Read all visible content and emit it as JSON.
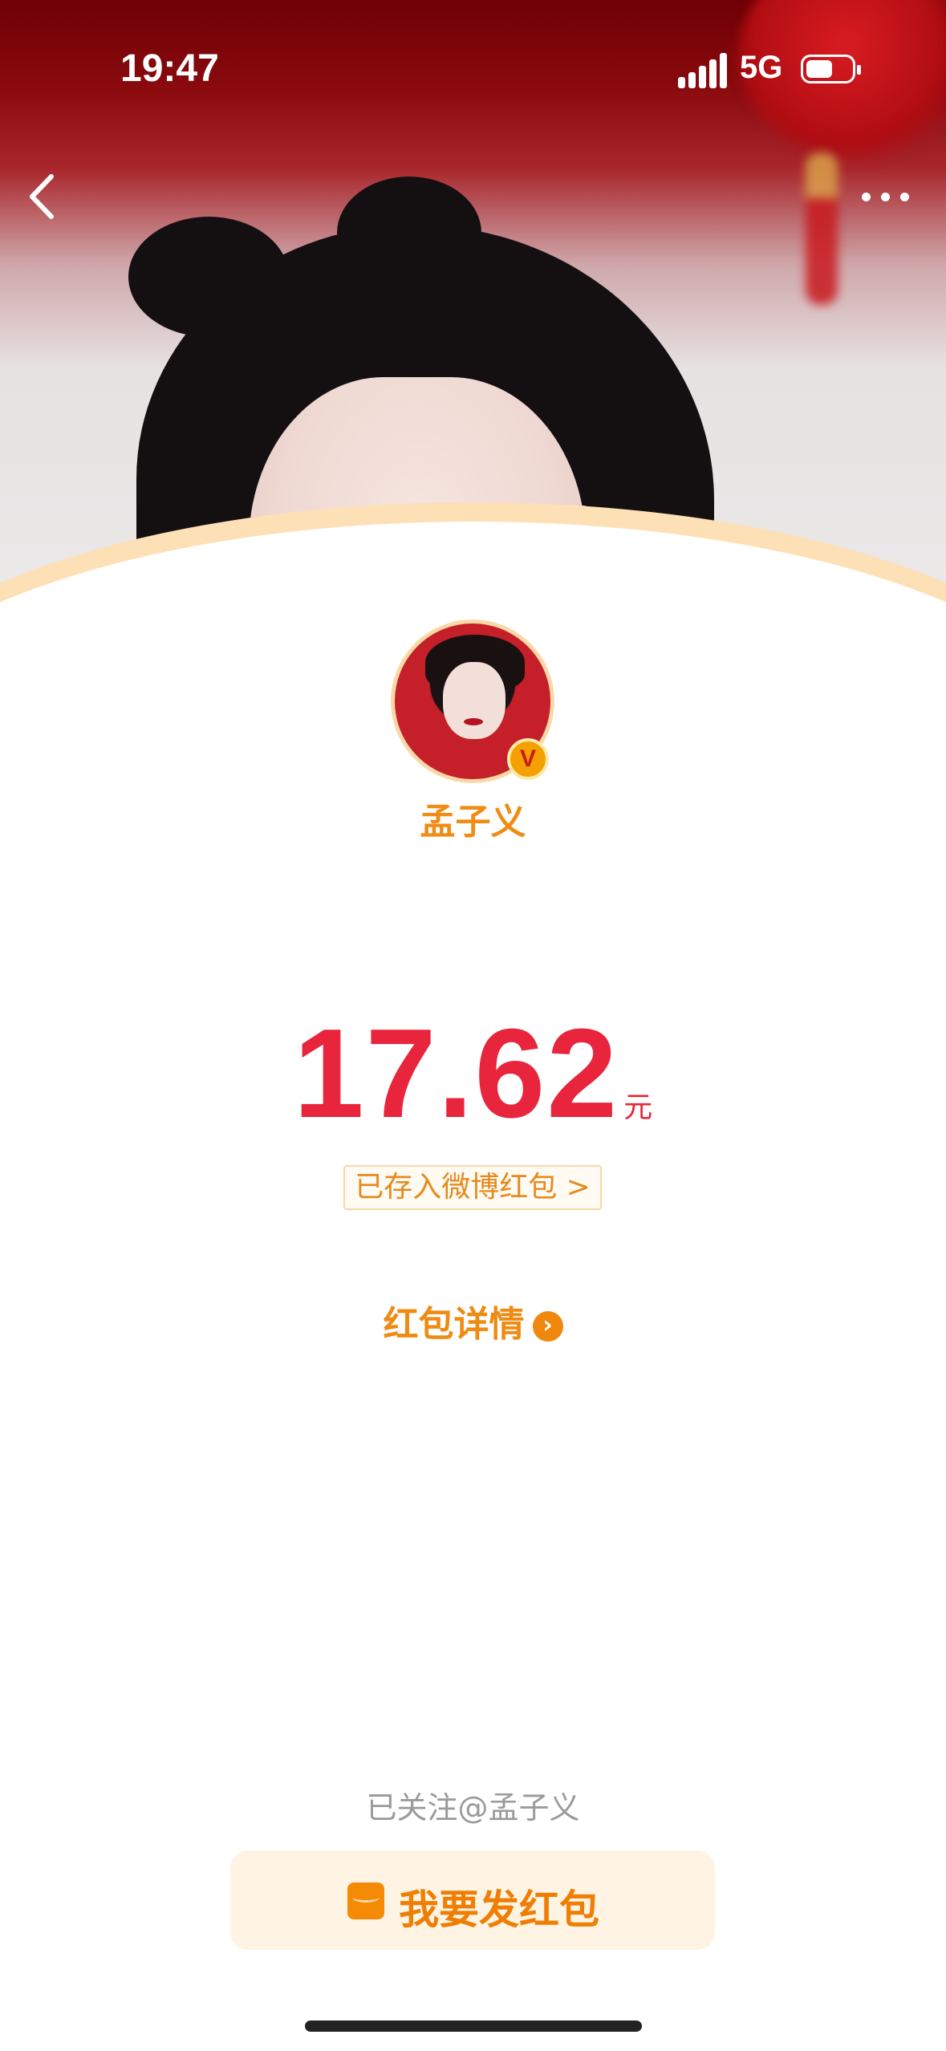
{
  "status_bar": {
    "time": "19:47",
    "network": "5G",
    "icons": [
      "signal-icon",
      "battery-icon"
    ]
  },
  "nav": {
    "back_icon": "chevron-left-icon",
    "more_icon": "more-horizontal-icon"
  },
  "sender": {
    "name": "孟子义",
    "verified": true,
    "badge_text": "V"
  },
  "red_packet": {
    "amount": "17.62",
    "unit": "元",
    "saved_label": "已存入微博红包 >",
    "details_label": "红包详情",
    "details_arrow": "›"
  },
  "footer": {
    "followed_text": "已关注@孟子义",
    "send_button_label": "我要发红包",
    "send_button_icon": "red-packet-icon"
  },
  "colors": {
    "amount": "#e8253d",
    "accent_orange": "#ef8a12",
    "header_red": "#8a0a0e"
  }
}
